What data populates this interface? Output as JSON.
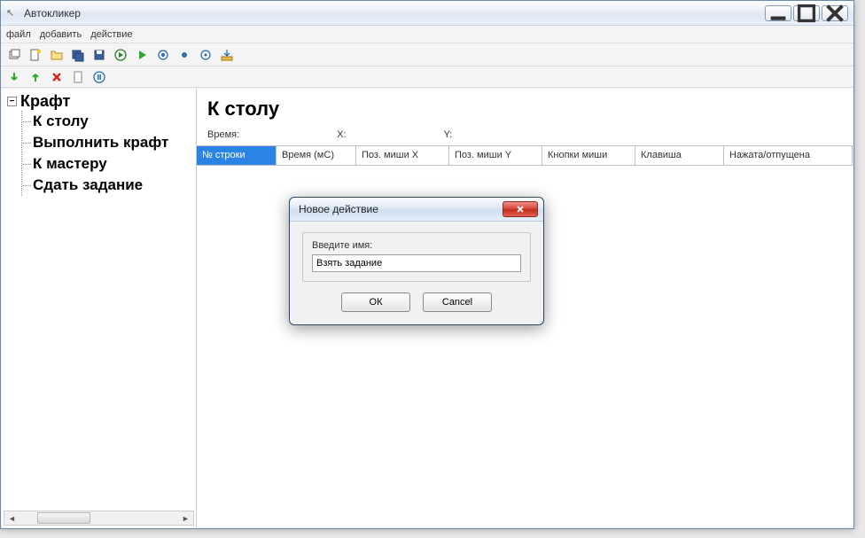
{
  "window": {
    "title": "Автокликер"
  },
  "menubar": {
    "file": "файл",
    "add": "добавить",
    "action": "действие"
  },
  "tree": {
    "root": "Крафт",
    "children": [
      "К столу",
      "Выполнить крафт",
      "К мастеру",
      "Сдать задание"
    ]
  },
  "section": {
    "title": "К столу",
    "time_label": "Время:",
    "x_label": "X:",
    "y_label": "Y:"
  },
  "table": {
    "headers": [
      "№ строки",
      "Время (мС)",
      "Поз. миши X",
      "Поз. миши Y",
      "Кнопки миши",
      "Клавиша",
      "Нажата/отпущена"
    ]
  },
  "dialog": {
    "title": "Новое действие",
    "field_label": "Введите имя:",
    "input_value": "Взять задание",
    "ok": "ОК",
    "cancel": "Cancel"
  }
}
